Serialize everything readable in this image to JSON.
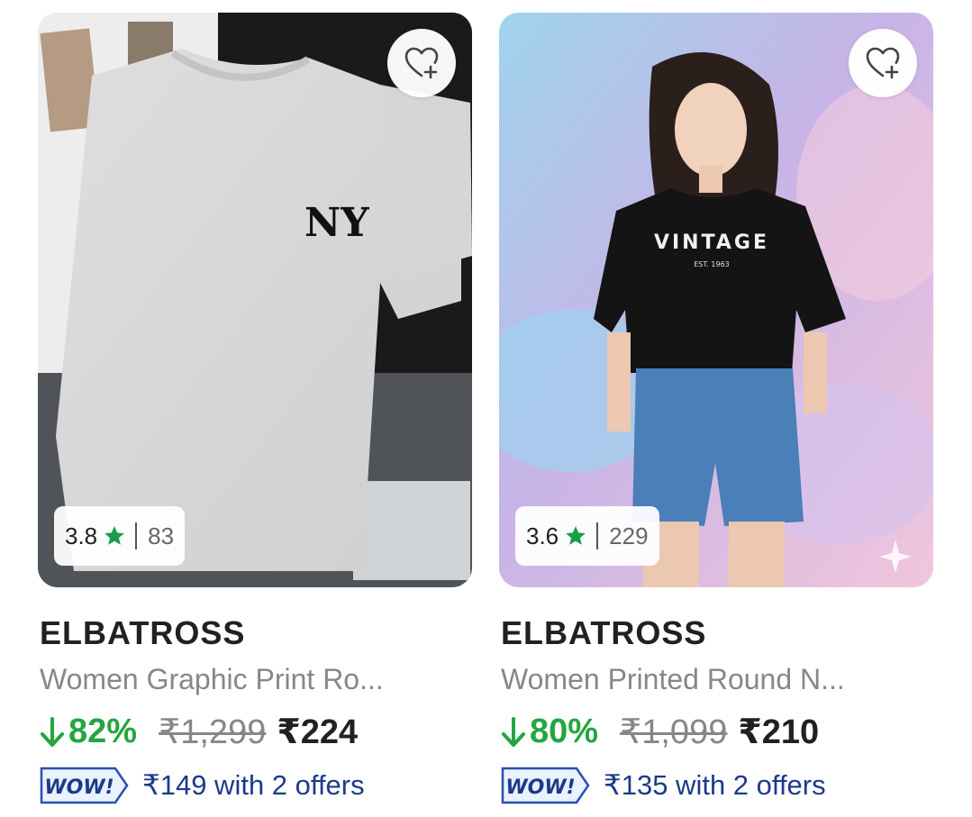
{
  "products": [
    {
      "brand": "ELBATROSS",
      "title": "Women Graphic Print Ro...",
      "rating": "3.8",
      "rating_count": "83",
      "discount": "82%",
      "mrp": "₹1,299",
      "price": "₹224",
      "wow_badge": "WOW!",
      "offer_text": "₹149 with 2 offers",
      "image_print_text": "NY"
    },
    {
      "brand": "ELBATROSS",
      "title": "Women Printed Round N...",
      "rating": "3.6",
      "rating_count": "229",
      "discount": "80%",
      "mrp": "₹1,099",
      "price": "₹210",
      "wow_badge": "WOW!",
      "offer_text": "₹135 with 2 offers",
      "image_print_text": "VINTAGE",
      "image_print_subtext": "EST. 1963"
    }
  ],
  "colors": {
    "discount_green": "#26a541",
    "star_green": "#1a9c4a",
    "offer_blue": "#1b3a8a",
    "muted_gray": "#878787"
  },
  "icons": [
    "wishlist-heart-plus-icon",
    "star-icon",
    "down-arrow-icon",
    "wow-badge-icon",
    "sparkle-icon"
  ]
}
